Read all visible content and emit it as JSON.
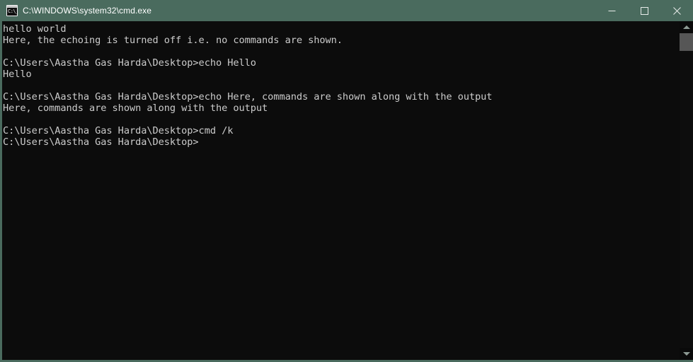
{
  "window": {
    "title": "C:\\WINDOWS\\system32\\cmd.exe",
    "icon": "cmd-console-icon",
    "icon_text": "C:\\_",
    "titlebar_color": "#4a6b5e",
    "titlebar_text_color": "#ffffff",
    "console_bg": "#0c0c0c",
    "console_fg": "#cccccc"
  },
  "controls": {
    "minimize_label": "Minimize",
    "maximize_label": "Maximize",
    "close_label": "Close"
  },
  "console": {
    "prompt": "C:\\Users\\Aastha Gas Harda\\Desktop>",
    "lines": [
      "hello world",
      "Here, the echoing is turned off i.e. no commands are shown.",
      "",
      "C:\\Users\\Aastha Gas Harda\\Desktop>echo Hello",
      "Hello",
      "",
      "C:\\Users\\Aastha Gas Harda\\Desktop>echo Here, commands are shown along with the output",
      "Here, commands are shown along with the output",
      "",
      "C:\\Users\\Aastha Gas Harda\\Desktop>cmd /k",
      "C:\\Users\\Aastha Gas Harda\\Desktop>"
    ],
    "text": "hello world\nHere, the echoing is turned off i.e. no commands are shown.\n\nC:\\Users\\Aastha Gas Harda\\Desktop>echo Hello\nHello\n\nC:\\Users\\Aastha Gas Harda\\Desktop>echo Here, commands are shown along with the output\nHere, commands are shown along with the output\n\nC:\\Users\\Aastha Gas Harda\\Desktop>cmd /k\nC:\\Users\\Aastha Gas Harda\\Desktop>"
  },
  "scrollbar": {
    "up_arrow": "scroll-up-arrow",
    "down_arrow": "scroll-down-arrow",
    "thumb_color": "#565656",
    "track_color": "#0d0d0d"
  }
}
